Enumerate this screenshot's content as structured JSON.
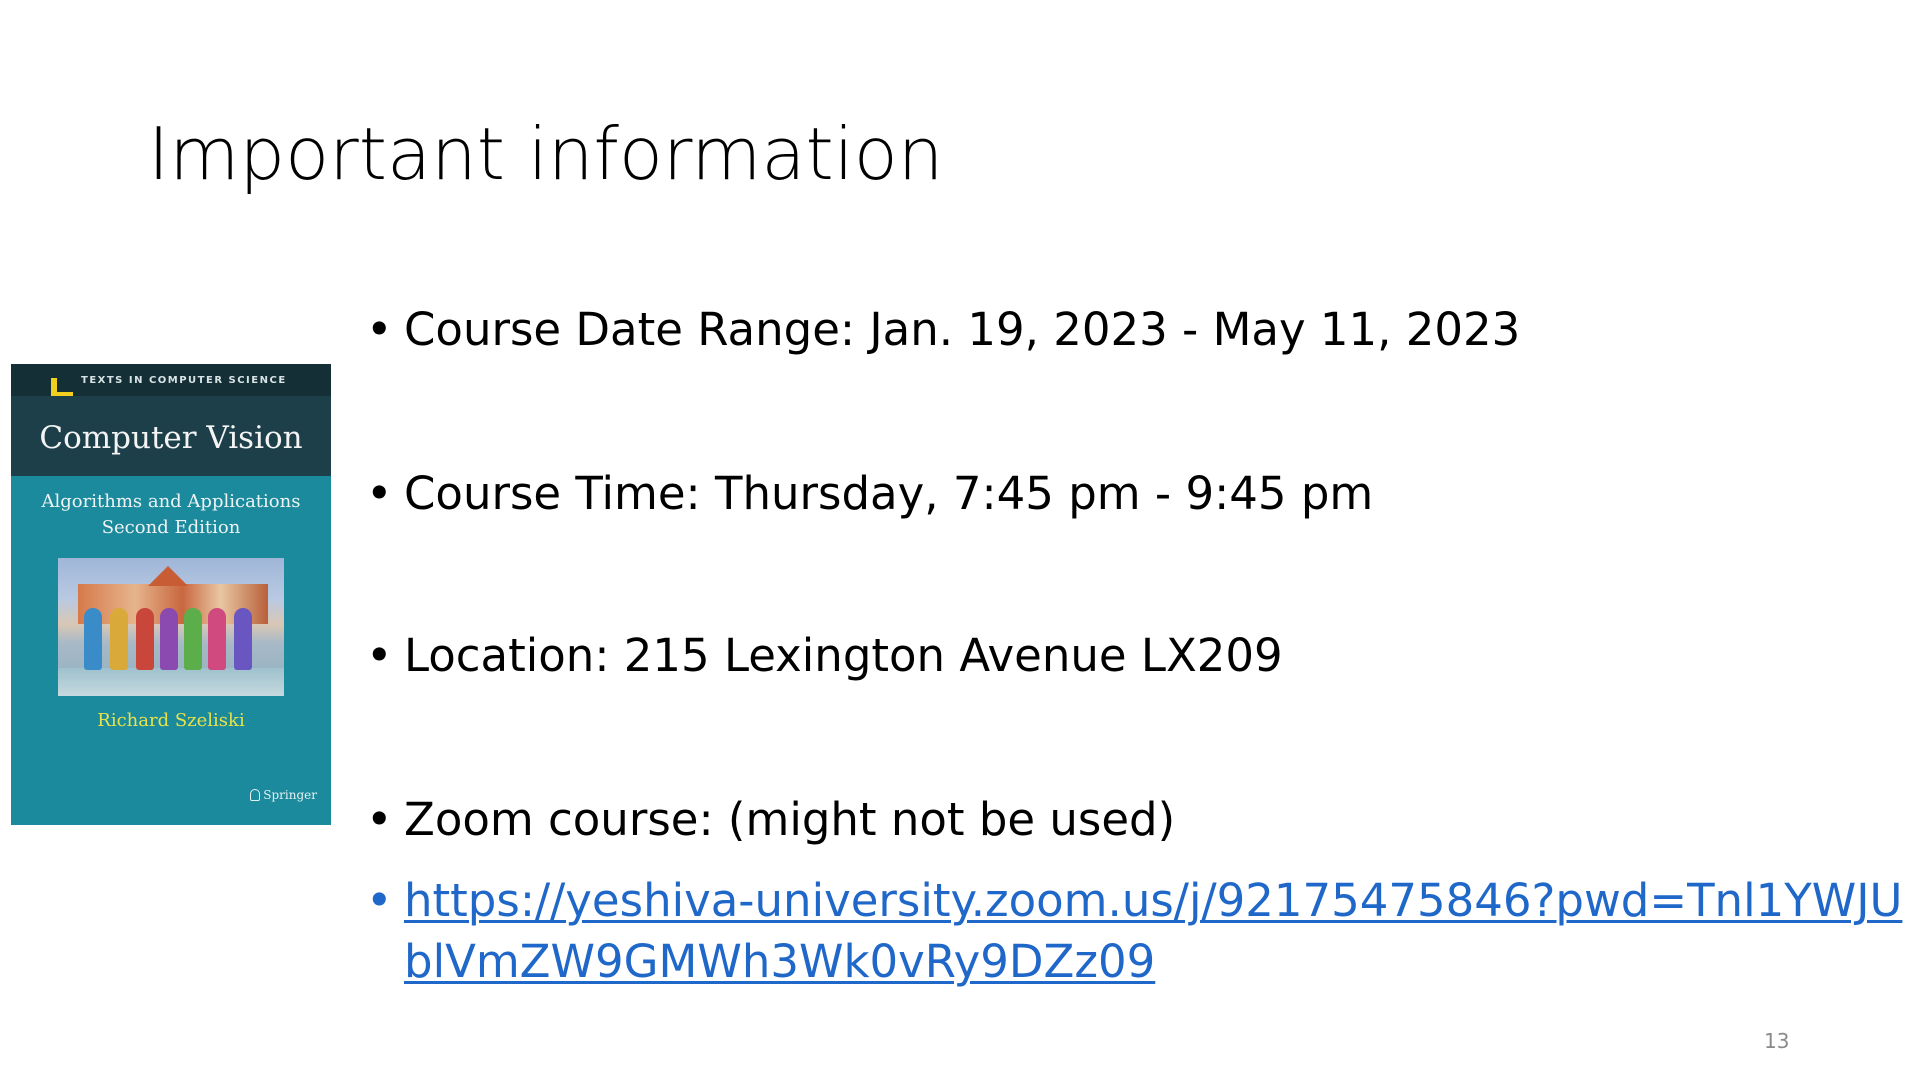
{
  "slide": {
    "title": "Important information",
    "page_number": "13"
  },
  "cover": {
    "series": "TEXTS IN COMPUTER SCIENCE",
    "title": "Computer Vision",
    "subtitle_line1": "Algorithms and Applications",
    "subtitle_line2": "Second Edition",
    "author": "Richard Szeliski",
    "publisher": "Springer",
    "colors": {
      "background": "#1b8a9c",
      "header": "#1c3f49",
      "author_text": "#e8e24a"
    }
  },
  "bullets": {
    "date_range": "Course Date Range: Jan. 19, 2023 - May 11, 2023",
    "time": "Course Time: Thursday, 7:45 pm - 9:45 pm",
    "location": "Location: 215 Lexington Avenue LX209",
    "zoom": "Zoom course: (might not be used)",
    "zoom_link": "https://yeshiva-university.zoom.us/j/92175475846?pwd=Tnl1YWJUblVmZW9GMWh3Wk0vRy9DZz09"
  },
  "colors": {
    "link": "#1f67c8",
    "text": "#000000",
    "page_number": "#8a8a8a"
  }
}
